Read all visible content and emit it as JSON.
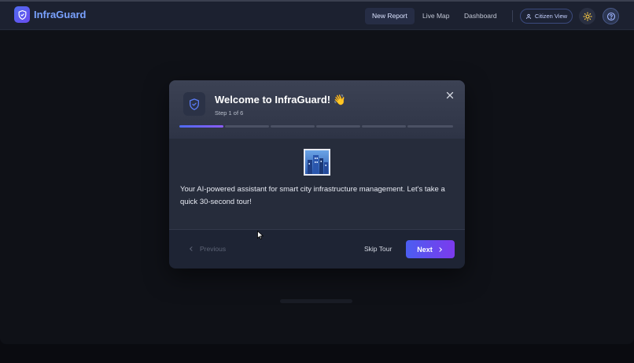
{
  "app": {
    "brand": "InfraGuard"
  },
  "nav": {
    "items": [
      {
        "label": "New Report",
        "active": true
      },
      {
        "label": "Live Map",
        "active": false
      },
      {
        "label": "Dashboard",
        "active": false
      }
    ],
    "citizen_view": "Citizen View"
  },
  "icons": {
    "logo": "shield-icon",
    "theme": "sun-icon",
    "help": "help-circle-icon",
    "user": "user-icon",
    "close": "close-icon",
    "illustration": "city-buildings-icon"
  },
  "modal": {
    "title": "Welcome to InfraGuard! 👋",
    "step": "Step 1 of 6",
    "progress": {
      "current": 1,
      "total": 6
    },
    "body": "Your AI-powered assistant for smart city infrastructure management. Let's take a quick 30-second tour!",
    "previous_label": "Previous",
    "skip_label": "Skip Tour",
    "next_label": "Next"
  },
  "colors": {
    "accent": "#4f6bf0",
    "accent_purple": "#8b5cf6",
    "brand_text": "#7aa2ff",
    "theme_sun": "#f5c542"
  }
}
